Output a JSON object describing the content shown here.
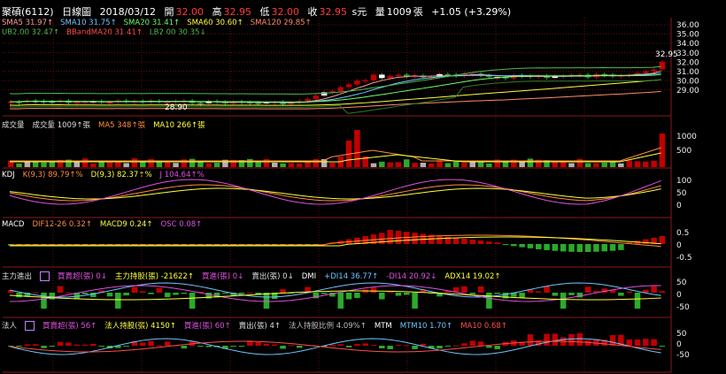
{
  "header": {
    "stock": "聚碩(6112)",
    "period": "日線圖",
    "date": "2018/03/12",
    "open_label": "開",
    "open": "32.00",
    "high_label": "高",
    "high": "32.95",
    "low_label": "低",
    "low": "32.00",
    "close_label": "收",
    "close": "32.95",
    "currency": "s元",
    "vol_label": "量",
    "volume": "1009",
    "vol_unit": "張",
    "change": "+1.05 (+3.29%)"
  },
  "ma_legend": [
    {
      "text": "SMA5 31.97↑",
      "color": "#ff9c9c"
    },
    {
      "text": "SMA10 31.75↑",
      "color": "#6ec6ff"
    },
    {
      "text": "SMA20 31.41↑",
      "color": "#6dff6d"
    },
    {
      "text": "SMA60 30.60↑",
      "color": "#ffff3c"
    },
    {
      "text": "SMA120 29.85↑",
      "color": "#ff8c69"
    }
  ],
  "bb_legend": [
    {
      "text": "UB2.00 32.47↑",
      "color": "#4dbd4d"
    },
    {
      "text": "BBandMA20 31.41↑",
      "color": "#ff4d4d"
    },
    {
      "text": "LB2.00 30.35↓",
      "color": "#4dbd4d"
    }
  ],
  "price_axis": [
    "36.00",
    "35.00",
    "34.00",
    "33.00",
    "32.00",
    "31.00",
    "30.00",
    "29.00"
  ],
  "price_high_label": "32.95",
  "price_low_label": "28.90",
  "volume_panel": {
    "labels": [
      {
        "text": "成交量",
        "color": "#ddd"
      },
      {
        "text": "成交量 1009↑張",
        "color": "#ddd"
      },
      {
        "text": "MA5 348↑張",
        "color": "#ff8c3c"
      },
      {
        "text": "MA10 266↑張",
        "color": "#ffff3c"
      }
    ],
    "axis": [
      "1000",
      "500"
    ]
  },
  "kdj_panel": {
    "labels": [
      {
        "text": "KDJ",
        "color": "#fff"
      },
      {
        "text": "K(9,3) 89.79↑%",
        "color": "#ff8c3c"
      },
      {
        "text": "D(9,3) 82.37↑%",
        "color": "#ffff3c"
      },
      {
        "text": "J 104.64↑%",
        "color": "#e050e0"
      }
    ],
    "axis": [
      "100",
      "50",
      "0"
    ]
  },
  "macd_panel": {
    "labels": [
      {
        "text": "MACD",
        "color": "#fff"
      },
      {
        "text": "DIF12-26 0.32↑",
        "color": "#ff8c3c"
      },
      {
        "text": "MACD9 0.24↑",
        "color": "#ffff3c"
      },
      {
        "text": "OSC 0.08↑",
        "color": "#e050e0"
      }
    ],
    "axis": [
      "0.5",
      "0",
      "-0.5"
    ]
  },
  "dmi_panel": {
    "labels": [
      {
        "text": "主力進出",
        "color": "#ddd"
      },
      {
        "text": "買賣超(張) 0↓",
        "color": "#e050e0"
      },
      {
        "text": "主力持股(張) -21622↑",
        "color": "#ffff3c"
      },
      {
        "text": "買進(張) 0↓",
        "color": "#e050e0"
      },
      {
        "text": "賣出(張) 0↓",
        "color": "#ddd"
      },
      {
        "text": "DMI",
        "color": "#fff"
      },
      {
        "text": "+DI14 36.77↑",
        "color": "#6ec6ff"
      },
      {
        "text": "-DI14 20.92↓",
        "color": "#e050e0"
      },
      {
        "text": "ADX14 19.02↑",
        "color": "#ffff3c"
      }
    ],
    "axis": [
      "50",
      "0",
      "-50"
    ]
  },
  "inst_panel": {
    "labels": [
      {
        "text": "法人",
        "color": "#ddd"
      },
      {
        "text": "買賣超(張) 56↑",
        "color": "#e050e0"
      },
      {
        "text": "法人持股(張) 4150↑",
        "color": "#ffff3c"
      },
      {
        "text": "買進(張) 60↑",
        "color": "#e050e0"
      },
      {
        "text": "賣出(張) 4↑",
        "color": "#ddd"
      },
      {
        "text": "法人持股比例 4.09%↑",
        "color": "#bbb"
      },
      {
        "text": "MTM",
        "color": "#fff"
      },
      {
        "text": "MTM10 1.70↑",
        "color": "#6ec6ff"
      },
      {
        "text": "MA10 0.68↑",
        "color": "#ff4d4d"
      }
    ],
    "axis": [
      "50",
      "0",
      "-50"
    ]
  },
  "colors": {
    "up": "#c00000",
    "down": "#2aaa2a",
    "flat": "#b0b0b0",
    "grid": "#5a1010"
  }
}
